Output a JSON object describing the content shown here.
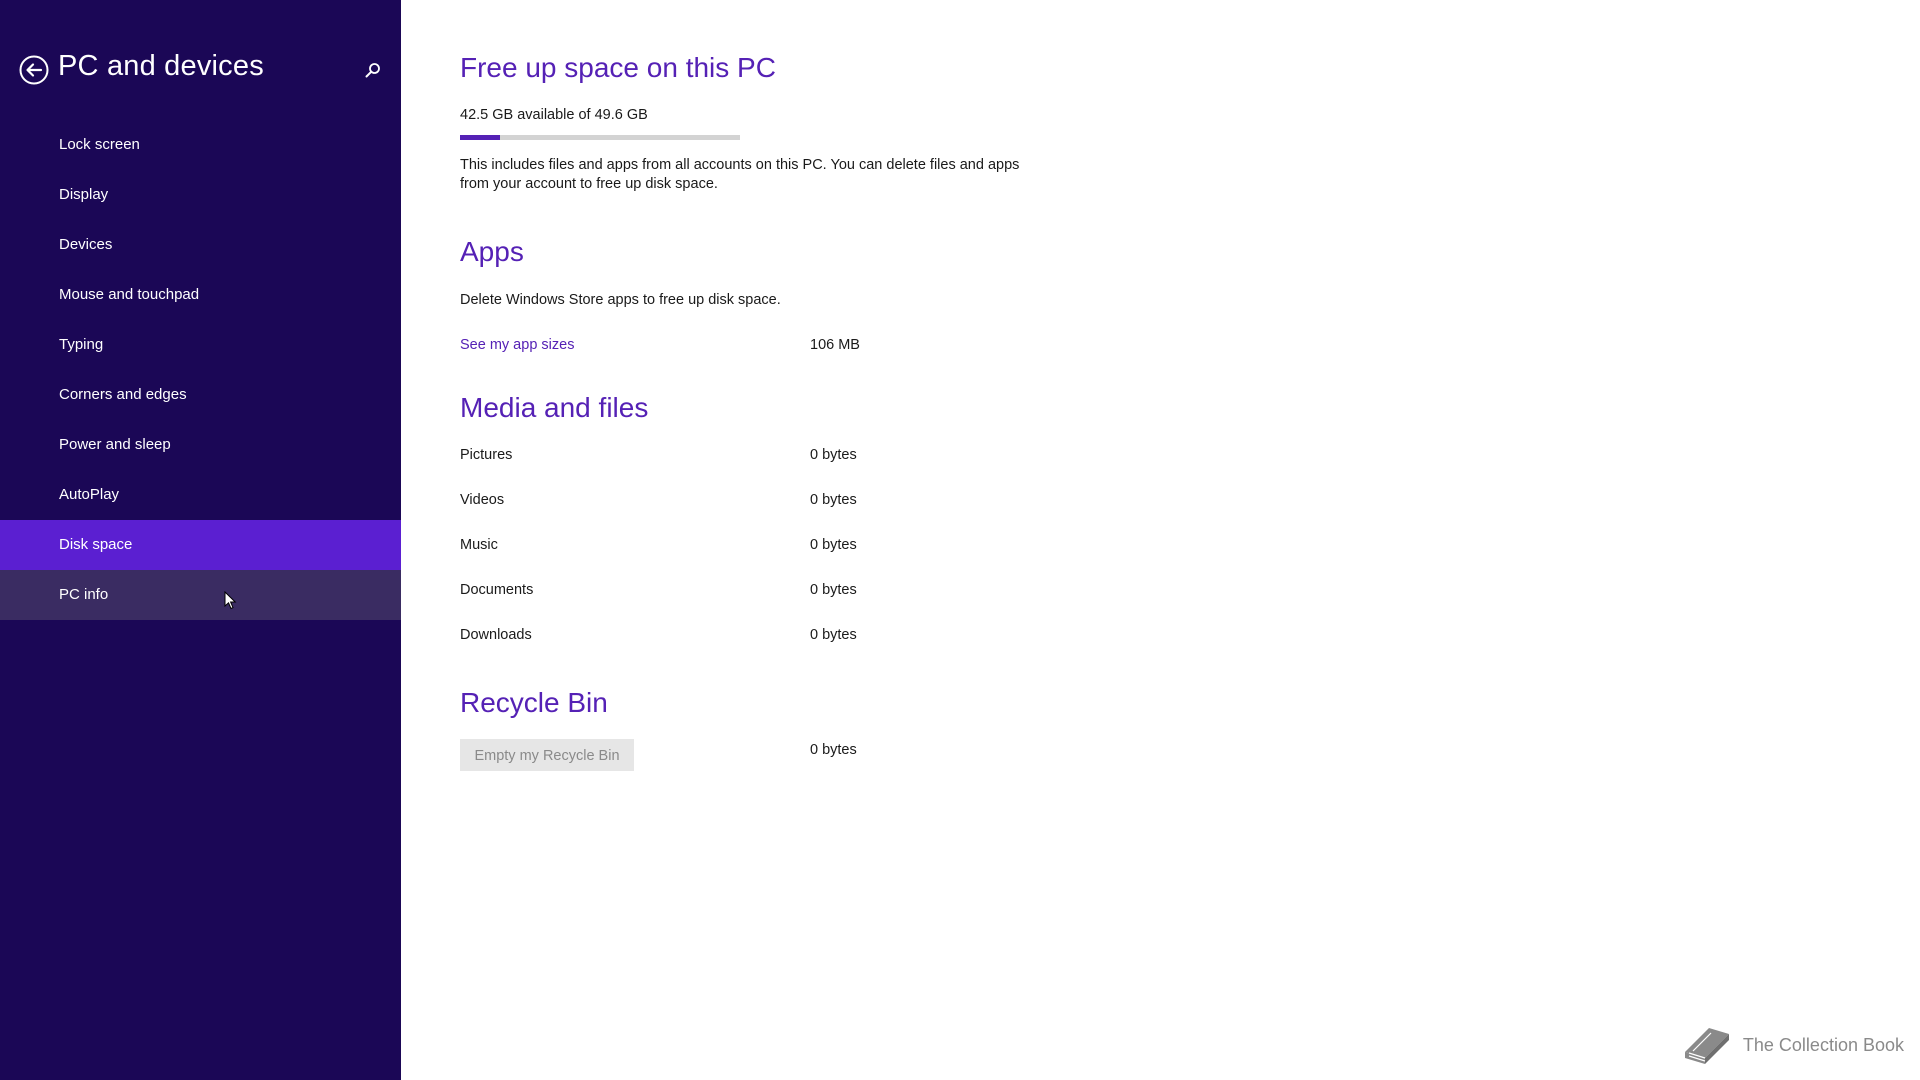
{
  "sidebar": {
    "title": "PC and devices",
    "back_icon": "back-arrow-icon",
    "search_icon": "search-icon",
    "items": [
      {
        "label": "Lock screen"
      },
      {
        "label": "Display"
      },
      {
        "label": "Devices"
      },
      {
        "label": "Mouse and touchpad"
      },
      {
        "label": "Typing"
      },
      {
        "label": "Corners and edges"
      },
      {
        "label": "Power and sleep"
      },
      {
        "label": "AutoPlay"
      },
      {
        "label": "Disk space"
      },
      {
        "label": "PC info"
      }
    ],
    "selected": "Disk space",
    "hovered": "PC info"
  },
  "main": {
    "title": "Free up space on this PC",
    "storage": {
      "text": "42.5 GB available of 49.6 GB",
      "used_fraction": 0.143
    },
    "description": "This includes files and apps from all accounts on this PC. You can delete files and apps from your account to free up disk space.",
    "apps": {
      "heading": "Apps",
      "text": "Delete Windows Store apps to free up disk space.",
      "link": "See my app sizes",
      "size": "106 MB"
    },
    "media": {
      "heading": "Media and files",
      "rows": [
        {
          "label": "Pictures",
          "value": "0 bytes"
        },
        {
          "label": "Videos",
          "value": "0 bytes"
        },
        {
          "label": "Music",
          "value": "0 bytes"
        },
        {
          "label": "Documents",
          "value": "0 bytes"
        },
        {
          "label": "Downloads",
          "value": "0 bytes"
        }
      ]
    },
    "recycle": {
      "heading": "Recycle Bin",
      "button": "Empty my Recycle Bin",
      "size": "0 bytes"
    }
  },
  "watermark": {
    "text": "The Collection Book",
    "icon": "book-icon"
  },
  "colors": {
    "sidebar_bg": "#1b0756",
    "selected_bg": "#5b1fd1",
    "hover_bg": "#3a2c62",
    "accent": "#5521b5"
  }
}
